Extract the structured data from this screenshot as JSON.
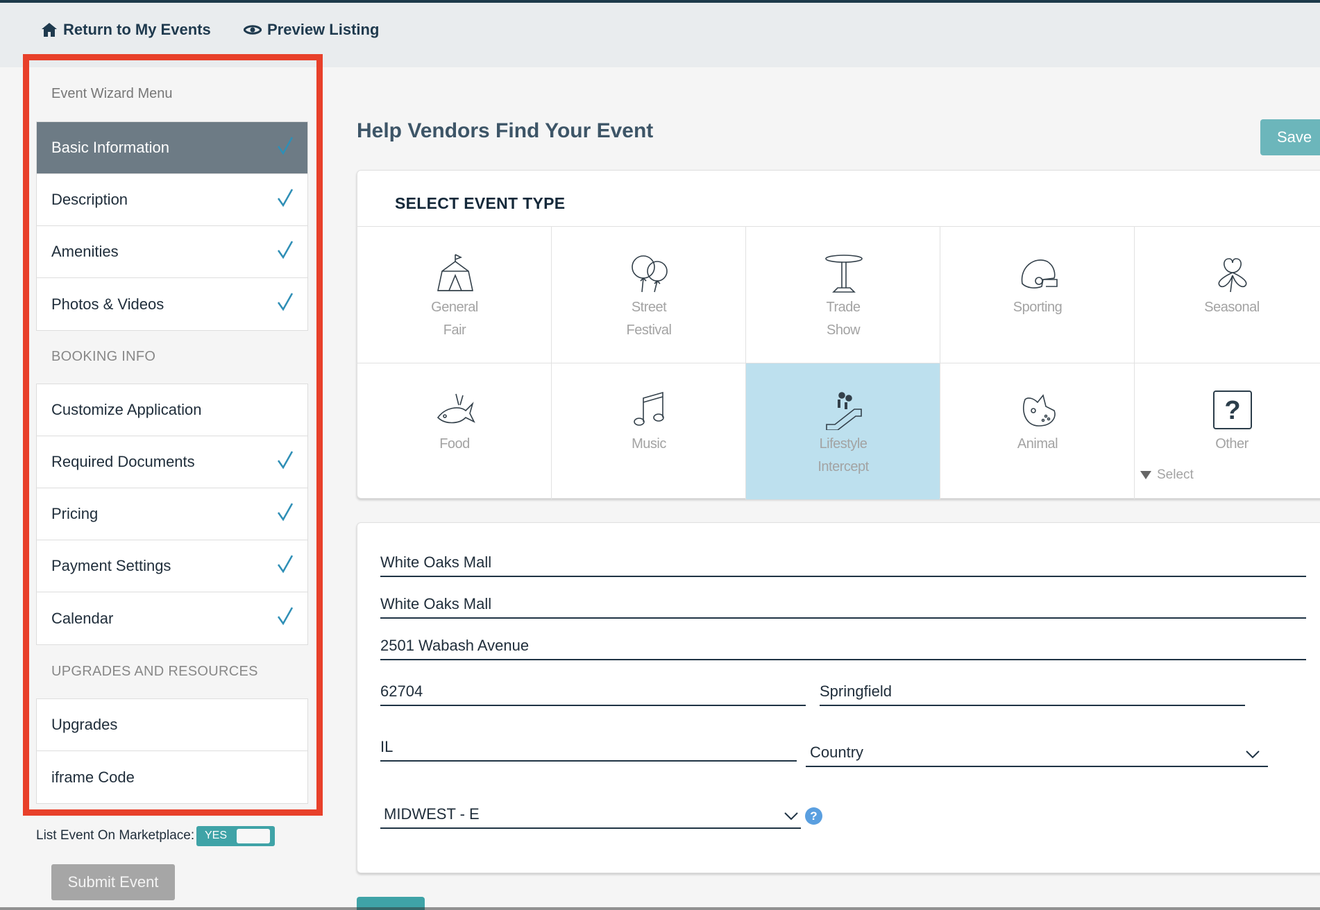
{
  "topbar": {
    "return_label": "Return to My Events",
    "preview_label": "Preview Listing"
  },
  "sidebar": {
    "wizard_title": "Event Wizard Menu",
    "group1": [
      {
        "label": "Basic Information",
        "done": true,
        "active": true
      },
      {
        "label": "Description",
        "done": true
      },
      {
        "label": "Amenities",
        "done": true
      },
      {
        "label": "Photos & Videos",
        "done": true
      }
    ],
    "booking_title": "BOOKING INFO",
    "group2": [
      {
        "label": "Customize Application",
        "done": false
      },
      {
        "label": "Required Documents",
        "done": true
      },
      {
        "label": "Pricing",
        "done": true
      },
      {
        "label": "Payment Settings",
        "done": true
      },
      {
        "label": "Calendar",
        "done": true
      }
    ],
    "upgrades_title": "UPGRADES AND RESOURCES",
    "group3": [
      {
        "label": "Upgrades",
        "done": false
      },
      {
        "label": "iframe Code",
        "done": false
      }
    ],
    "marketplace_label": "List Event On Marketplace:",
    "marketplace_toggle": "YES",
    "submit_label": "Submit Event"
  },
  "main": {
    "heading": "Help Vendors Find Your Event",
    "save_label": "Save",
    "event_type_title": "SELECT EVENT TYPE",
    "types": [
      {
        "line1": "General",
        "line2": "Fair",
        "icon": "tent-icon"
      },
      {
        "line1": "Street",
        "line2": "Festival",
        "icon": "balloons-icon"
      },
      {
        "line1": "Trade",
        "line2": "Show",
        "icon": "table-icon"
      },
      {
        "line1": "Sporting",
        "line2": "",
        "icon": "helmet-icon"
      },
      {
        "line1": "Seasonal",
        "line2": "",
        "icon": "shamrock-icon"
      },
      {
        "line1": "Food",
        "line2": "",
        "icon": "fish-icon"
      },
      {
        "line1": "Music",
        "line2": "",
        "icon": "music-note-icon"
      },
      {
        "line1": "Lifestyle",
        "line2": "Intercept",
        "icon": "escalator-icon",
        "selected": true
      },
      {
        "line1": "Animal",
        "line2": "",
        "icon": "pig-icon"
      },
      {
        "line1": "Other",
        "line2": "",
        "icon": "question-icon",
        "select_label": "Select"
      }
    ],
    "location": {
      "venue_name": "White Oaks Mall",
      "venue_name2": "White Oaks Mall",
      "address": "2501 Wabash Avenue",
      "zip": "62704",
      "city": "Springfield",
      "state": "IL",
      "country": "Country",
      "region": "MIDWEST - E"
    }
  },
  "colors": {
    "accent_teal": "#3fa3a7",
    "highlight_outline": "#e8402a",
    "selected_tile": "#bde0ee",
    "active_menu": "#6d7b85",
    "check": "#2f8fb6"
  }
}
